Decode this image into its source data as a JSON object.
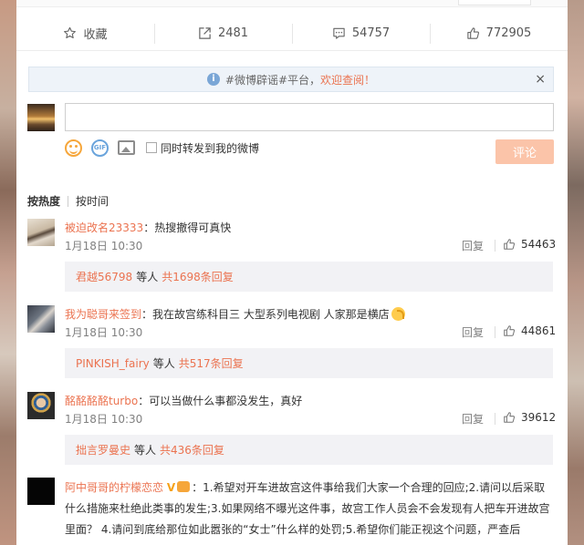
{
  "actions": [
    {
      "label": "收藏",
      "icon": "star-icon"
    },
    {
      "label": "2481",
      "icon": "share-icon"
    },
    {
      "label": "54757",
      "icon": "comment-icon"
    },
    {
      "label": "772905",
      "icon": "thumbs-up-icon"
    }
  ],
  "notice": {
    "text": "#微博辟谣#平台，",
    "link": "欢迎查阅！",
    "close": "×"
  },
  "composer": {
    "input_value": "",
    "sync_label": "同时转发到我的微博",
    "submit_label": "评论"
  },
  "sort": {
    "hot": "按热度",
    "time": "按时间"
  },
  "comments": [
    {
      "user": "被迫改名23333",
      "text": "：热搜撤得可真快",
      "time": "1月18日 10:30",
      "reply": "回复",
      "likes": "54463",
      "sub": {
        "name": "君越56798",
        "mid": "等人",
        "total": "共1698条回复"
      }
    },
    {
      "user": "我为聪哥来签到",
      "text": "：我在故宫练科目三 大型系列电视剧 人家那是横店",
      "time": "1月18日 10:30",
      "reply": "回复",
      "likes": "44861",
      "sub": {
        "name": "PINKISH_fairy",
        "mid": "等人",
        "total": "共517条回复"
      }
    },
    {
      "user": "酩酩酩酩turbo",
      "text": "：可以当做什么事都没发生，真好",
      "time": "1月18日 10:30",
      "reply": "回复",
      "likes": "39612",
      "sub": {
        "name": "拙言罗曼史",
        "mid": "等人",
        "total": "共436条回复"
      }
    },
    {
      "user": "阿中哥哥的柠檬恋恋",
      "badge": "V",
      "text": "：1.希望对开车进故宫这件事给我们大家一个合理的回应;2.请问以后采取什么措施来杜绝此类事的发生;3.如果网络不曝光这件事，故宫工作人员会不会发现有人把车开进故宫里面？ 4.请问到底给那位如此嚣张的“女士”什么样的处罚;5.希望你们能正视这个问题，严查后"
    }
  ],
  "colors": {
    "accent": "#eb7350",
    "submit_bg": "#fbc4a9",
    "notice_bg": "#eef3f9",
    "sub_bg": "#f2f2f5"
  }
}
